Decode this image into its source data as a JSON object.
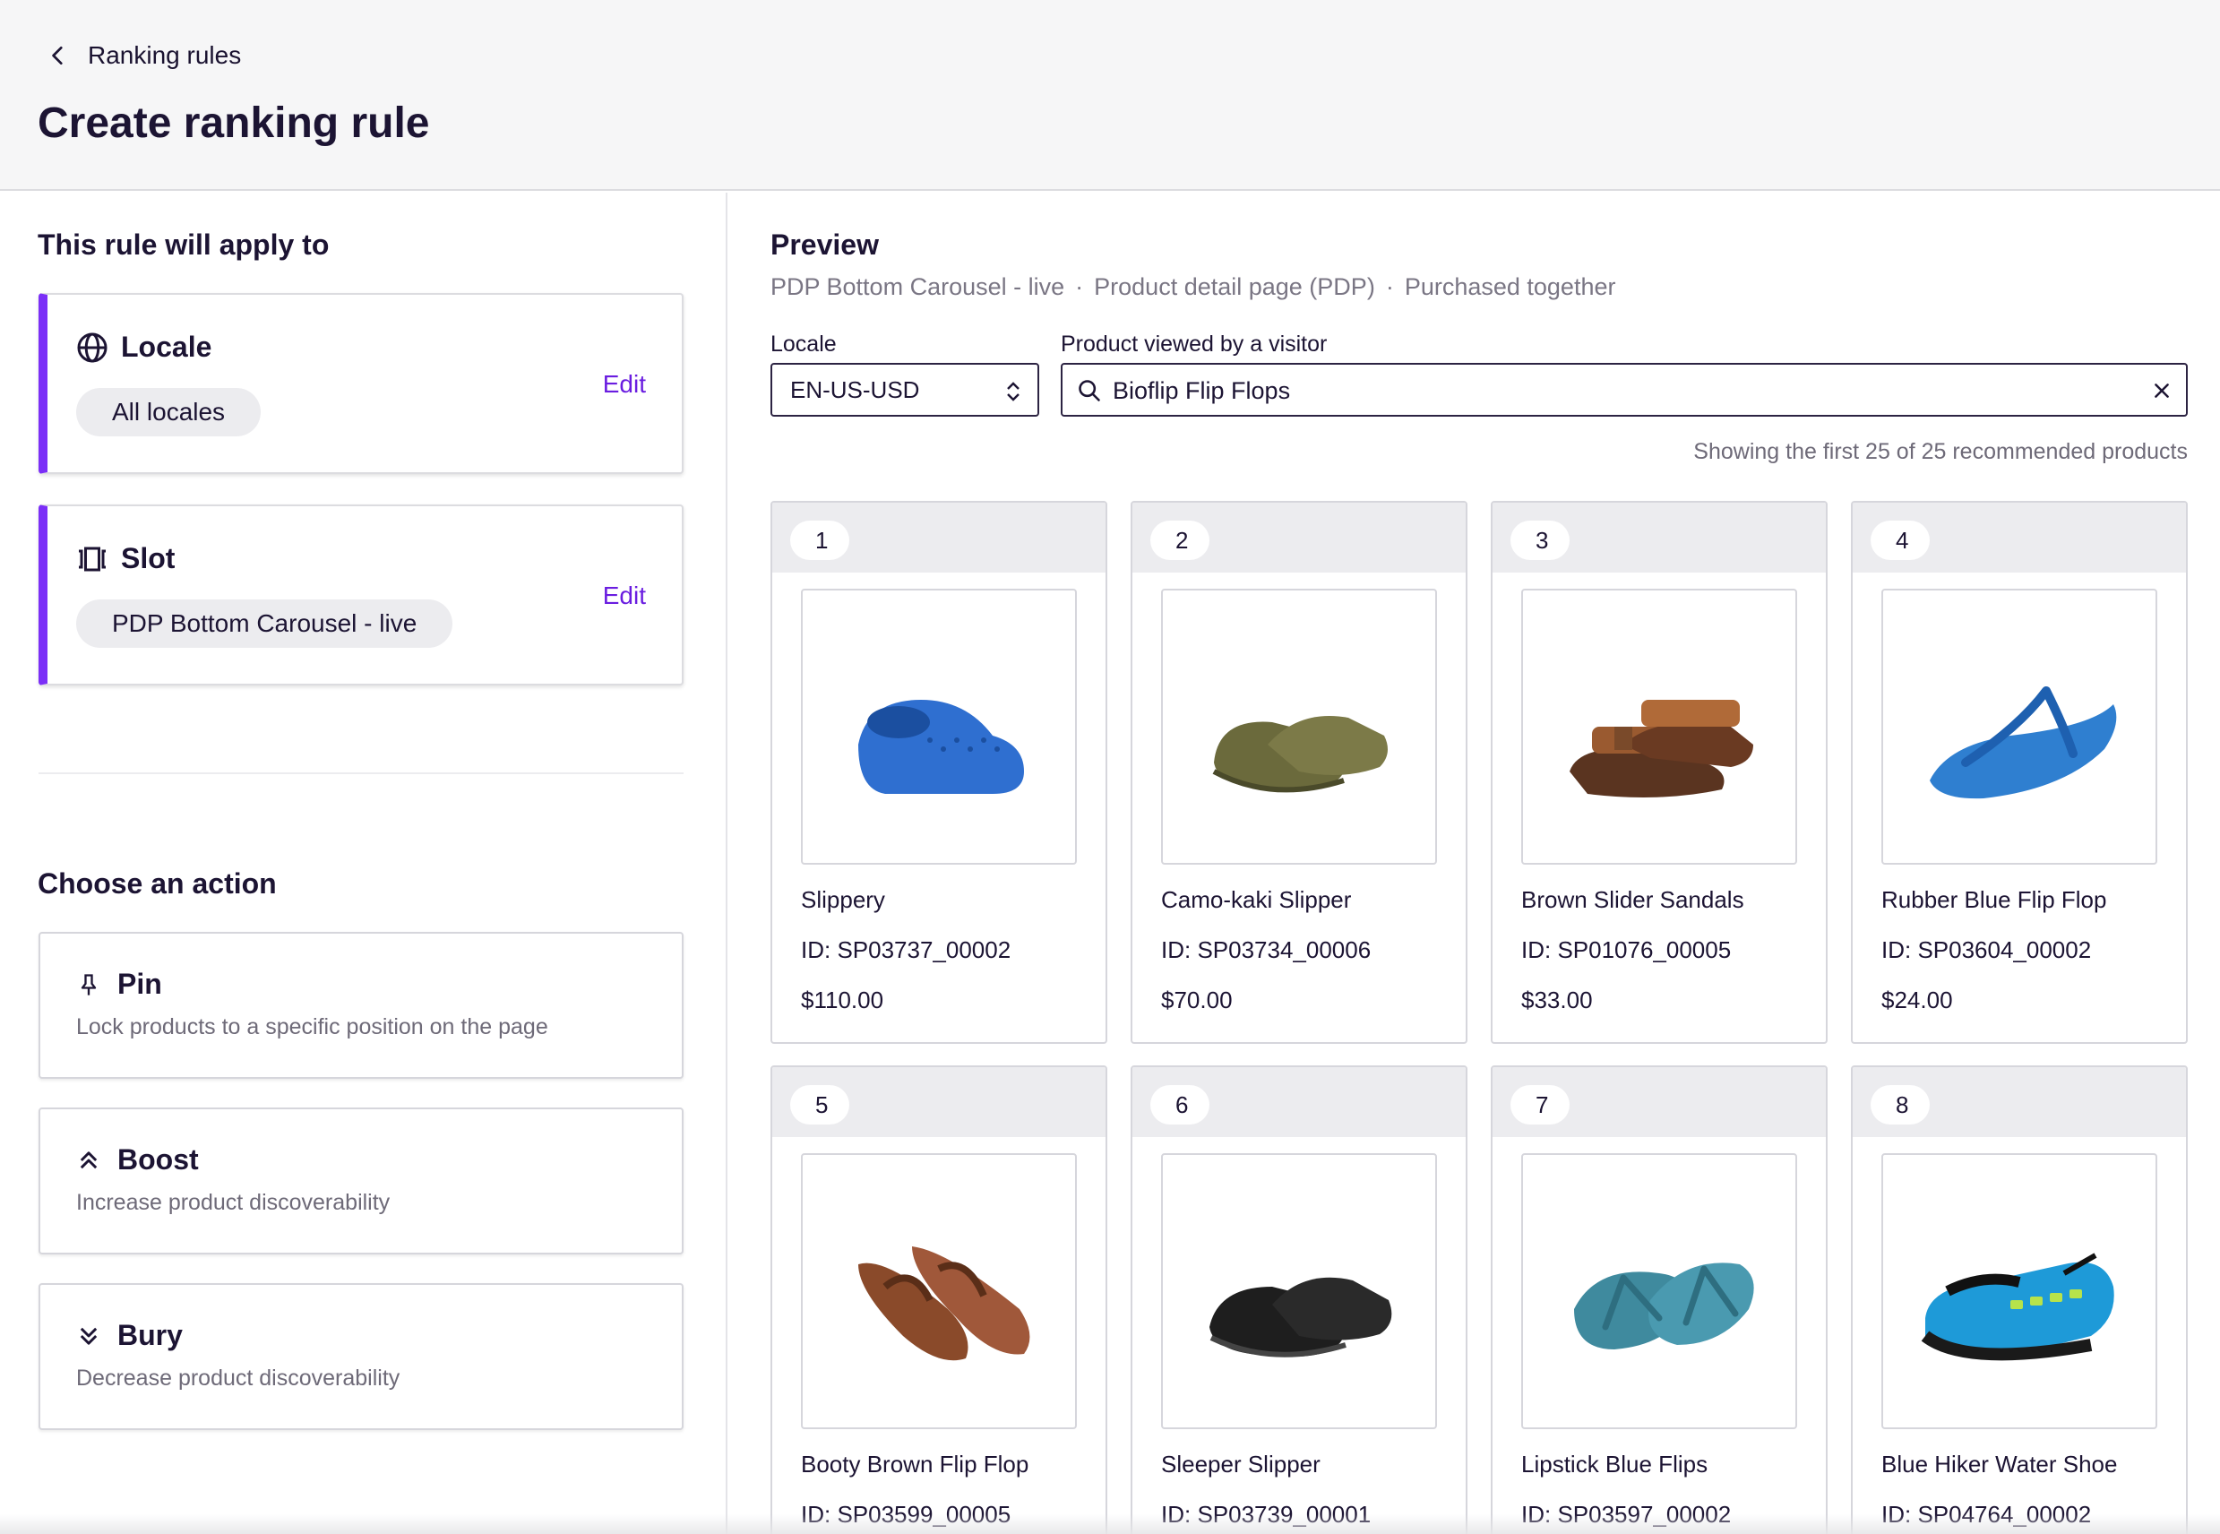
{
  "header": {
    "back_label": "Ranking rules",
    "title": "Create ranking rule"
  },
  "scope": {
    "title": "This rule will apply to",
    "locale": {
      "label": "Locale",
      "value": "All locales",
      "edit": "Edit"
    },
    "slot": {
      "label": "Slot",
      "value": "PDP Bottom Carousel - live",
      "edit": "Edit"
    },
    "accent_color": "#7b2ff7"
  },
  "actions": {
    "title": "Choose an action",
    "items": [
      {
        "label": "Pin",
        "desc": "Lock products to a specific position on the page",
        "icon": "pin-icon"
      },
      {
        "label": "Boost",
        "desc": "Increase product discoverability",
        "icon": "boost-icon"
      },
      {
        "label": "Bury",
        "desc": "Decrease product discoverability",
        "icon": "bury-icon"
      }
    ]
  },
  "preview": {
    "title": "Preview",
    "crumbs": [
      "PDP Bottom Carousel - live",
      "·",
      "Product detail page (PDP)",
      "·",
      "Purchased together"
    ],
    "locale_label": "Locale",
    "locale_value": "EN-US-USD",
    "product_label": "Product viewed by a visitor",
    "product_value": "Bioflip Flip Flops",
    "showing": "Showing the first 25 of 25 recommended products",
    "products": [
      {
        "rank": "1",
        "name": "Slippery",
        "id": "ID: SP03737_00002",
        "price": "$110.00",
        "icon": "blue-clog-image",
        "color": "#2f6fd0"
      },
      {
        "rank": "2",
        "name": "Camo-kaki Slipper",
        "id": "ID: SP03734_00006",
        "price": "$70.00",
        "icon": "khaki-slipper-image",
        "color": "#6b6a3c"
      },
      {
        "rank": "3",
        "name": "Brown Slider Sandals",
        "id": "ID: SP01076_00005",
        "price": "$33.00",
        "icon": "brown-sandal-image",
        "color": "#9a5a30"
      },
      {
        "rank": "4",
        "name": "Rubber Blue Flip Flop",
        "id": "ID: SP03604_00002",
        "price": "$24.00",
        "icon": "blue-flipflop-image",
        "color": "#2f7fd0"
      },
      {
        "rank": "5",
        "name": "Booty Brown Flip Flop",
        "id": "ID: SP03599_00005",
        "price": "",
        "icon": "brown-flipflop-image",
        "color": "#8a4a2a"
      },
      {
        "rank": "6",
        "name": "Sleeper Slipper",
        "id": "ID: SP03739_00001",
        "price": "",
        "icon": "black-slipper-image",
        "color": "#1e1e1e"
      },
      {
        "rank": "7",
        "name": "Lipstick Blue Flips",
        "id": "ID: SP03597_00002",
        "price": "",
        "icon": "teal-flipflop-image",
        "color": "#3f8a9e"
      },
      {
        "rank": "8",
        "name": "Blue Hiker Water Shoe",
        "id": "ID: SP04764_00002",
        "price": "",
        "icon": "water-shoe-image",
        "color": "#1e9ad8"
      }
    ]
  }
}
